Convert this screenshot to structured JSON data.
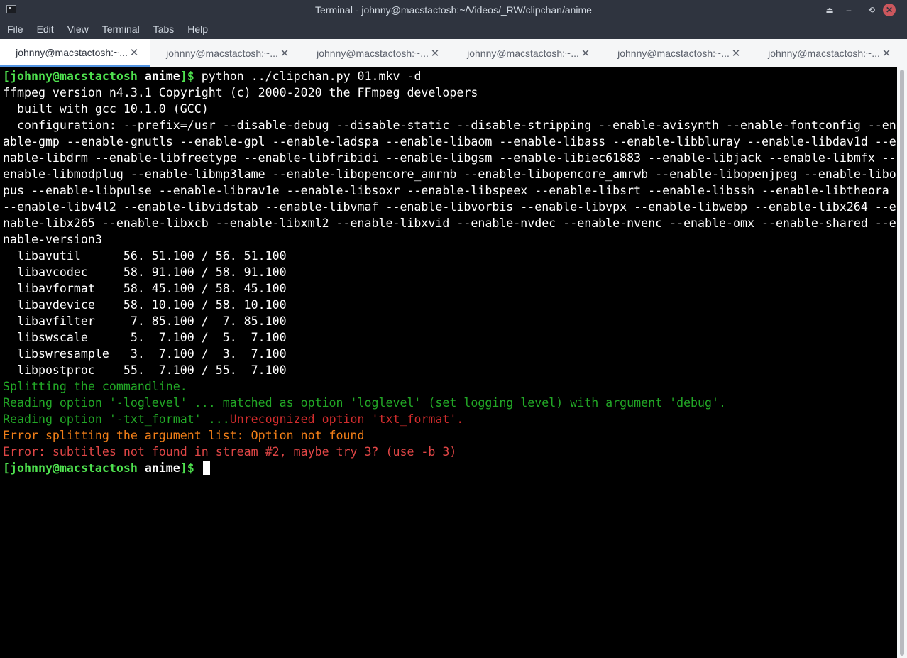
{
  "window": {
    "title": "Terminal - johnny@macstactosh:~/Videos/_RW/clipchan/anime",
    "controls": {
      "eject": "⏏",
      "minimize": "–",
      "maximize": "⟲",
      "close": "✕"
    }
  },
  "menu": [
    "File",
    "Edit",
    "View",
    "Terminal",
    "Tabs",
    "Help"
  ],
  "tabs": [
    {
      "label": "johnny@macstactosh:~...",
      "active": true
    },
    {
      "label": "johnny@macstactosh:~...",
      "active": false
    },
    {
      "label": "johnny@macstactosh:~...",
      "active": false
    },
    {
      "label": "johnny@macstactosh:~...",
      "active": false
    },
    {
      "label": "johnny@macstactosh:~...",
      "active": false
    },
    {
      "label": "johnny@macstactosh:~...",
      "active": false
    }
  ],
  "tab_close_glyph": "✕",
  "prompt": {
    "user": "[johnny@macstactosh",
    "dir": "anime",
    "end": "]$"
  },
  "terminal": {
    "command": "python ../clipchan.py 01.mkv -d",
    "output": [
      "ffmpeg version n4.3.1 Copyright (c) 2000-2020 the FFmpeg developers",
      "  built with gcc 10.1.0 (GCC)",
      "  configuration: --prefix=/usr --disable-debug --disable-static --disable-stripping --enable-avisynth --enable-fontconfig --en",
      "able-gmp --enable-gnutls --enable-gpl --enable-ladspa --enable-libaom --enable-libass --enable-libbluray --enable-libdav1d --e",
      "nable-libdrm --enable-libfreetype --enable-libfribidi --enable-libgsm --enable-libiec61883 --enable-libjack --enable-libmfx --",
      "enable-libmodplug --enable-libmp3lame --enable-libopencore_amrnb --enable-libopencore_amrwb --enable-libopenjpeg --enable-libo",
      "pus --enable-libpulse --enable-librav1e --enable-libsoxr --enable-libspeex --enable-libsrt --enable-libssh --enable-libtheora ",
      "--enable-libv4l2 --enable-libvidstab --enable-libvmaf --enable-libvorbis --enable-libvpx --enable-libwebp --enable-libx264 --e",
      "nable-libx265 --enable-libxcb --enable-libxml2 --enable-libxvid --enable-nvdec --enable-nvenc --enable-omx --enable-shared --e",
      "nable-version3",
      "  libavutil      56. 51.100 / 56. 51.100",
      "  libavcodec     58. 91.100 / 58. 91.100",
      "  libavformat    58. 45.100 / 58. 45.100",
      "  libavdevice    58. 10.100 / 58. 10.100",
      "  libavfilter     7. 85.100 /  7. 85.100",
      "  libswscale      5.  7.100 /  5.  7.100",
      "  libswresample   3.  7.100 /  3.  7.100",
      "  libpostproc    55.  7.100 / 55.  7.100"
    ],
    "splitting": "Splitting the commandline.",
    "reading_loglevel": "Reading option '-loglevel' ... matched as option 'loglevel' (set logging level) with argument 'debug'.",
    "reading_txt_prefix": "Reading option '-txt_format' ...",
    "reading_txt_error": "Unrecognized option 'txt_format'.",
    "error_split": "Error splitting the argument list: Option not found",
    "error_subs": "Error: subtitles not found in stream #2, maybe try 3? (use -b 3)"
  },
  "colors": {
    "prompt_user": "#4fe34f",
    "debug_green": "#22a826",
    "error_red": "#d22d2d",
    "warn_orange": "#f07e18",
    "tab_accent": "#5294e2"
  }
}
